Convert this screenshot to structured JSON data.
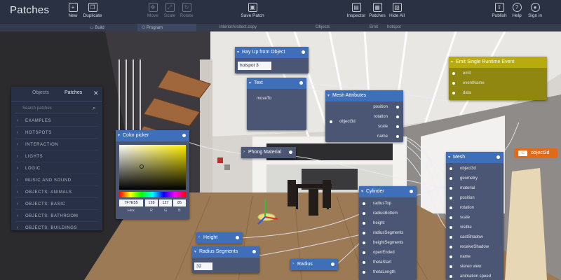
{
  "app": {
    "title": "Patches"
  },
  "toolbar": {
    "new": "New",
    "duplicate": "Duplicate",
    "move": "Move",
    "scale": "Scale",
    "rotate": "Rotate",
    "save": "Save Patch",
    "inspector": "Inspector",
    "patches": "Patches",
    "hide_all": "Hide All",
    "publish": "Publish",
    "help": "Help",
    "sign_in": "Sign in"
  },
  "subbar": {
    "build": "Build",
    "program": "Program",
    "file": "interiorAroitect.copy",
    "objects": "Objects",
    "emit": "Emit",
    "hotspot": "hotspot"
  },
  "objects_panel": {
    "tab_objects": "Objects",
    "tab_patches": "Patches",
    "search_placeholder": "Search patches",
    "items": [
      "EXAMPLES",
      "HOTSPOTS",
      "INTERACTION",
      "LIGHTS",
      "LOGIC",
      "MUSIC AND SOUND",
      "OBJECTS: ANIMALS",
      "OBJECTS: BASIC",
      "OBJECTS: BATHROOM",
      "OBJECTS: BUILDINGS"
    ]
  },
  "ray_node": {
    "title": "Ray Up from Object",
    "value": "hotspot 3"
  },
  "text_node": {
    "title": "Text",
    "port": "moveTo"
  },
  "mesh_attr_node": {
    "title": "Mesh Attributes",
    "in": "object3d",
    "ports": [
      "position",
      "rotation",
      "scale",
      "name"
    ]
  },
  "emit_node": {
    "title": "Emit Single Runtime Event",
    "ports": [
      "emit",
      "eventName",
      "data"
    ]
  },
  "object3d_badge": {
    "label": "object3d"
  },
  "color_picker": {
    "title": "Color picker",
    "hex": "7F7E55",
    "r": "128",
    "g": "127",
    "b": "85",
    "l_hex": "Hex",
    "l_r": "R",
    "l_g": "G",
    "l_b": "B"
  },
  "phong_node": {
    "title": "Phong Material"
  },
  "cylinder_node": {
    "title": "Cylinder",
    "ports": [
      "radiusTop",
      "radiusBottom",
      "height",
      "radiusSegments",
      "heightSegments",
      "openEnded",
      "thetaStart",
      "thetaLength"
    ]
  },
  "mesh_node": {
    "title": "Mesh",
    "ports": [
      "object3d",
      "geometry",
      "material",
      "position",
      "rotation",
      "scale",
      "visible",
      "castShadow",
      "receiveShadow",
      "name",
      "stereo view",
      "animation speed"
    ]
  },
  "height_node": {
    "title": "Height"
  },
  "radius_seg_node": {
    "title": "Radius Segments",
    "value": "32"
  },
  "radius_node": {
    "title": "Radius"
  },
  "colors": {
    "toolbar": "#2a3142",
    "node_header": "#3f6fb8",
    "emit_header": "#b7ab0e",
    "badge": "#e06a1a"
  }
}
